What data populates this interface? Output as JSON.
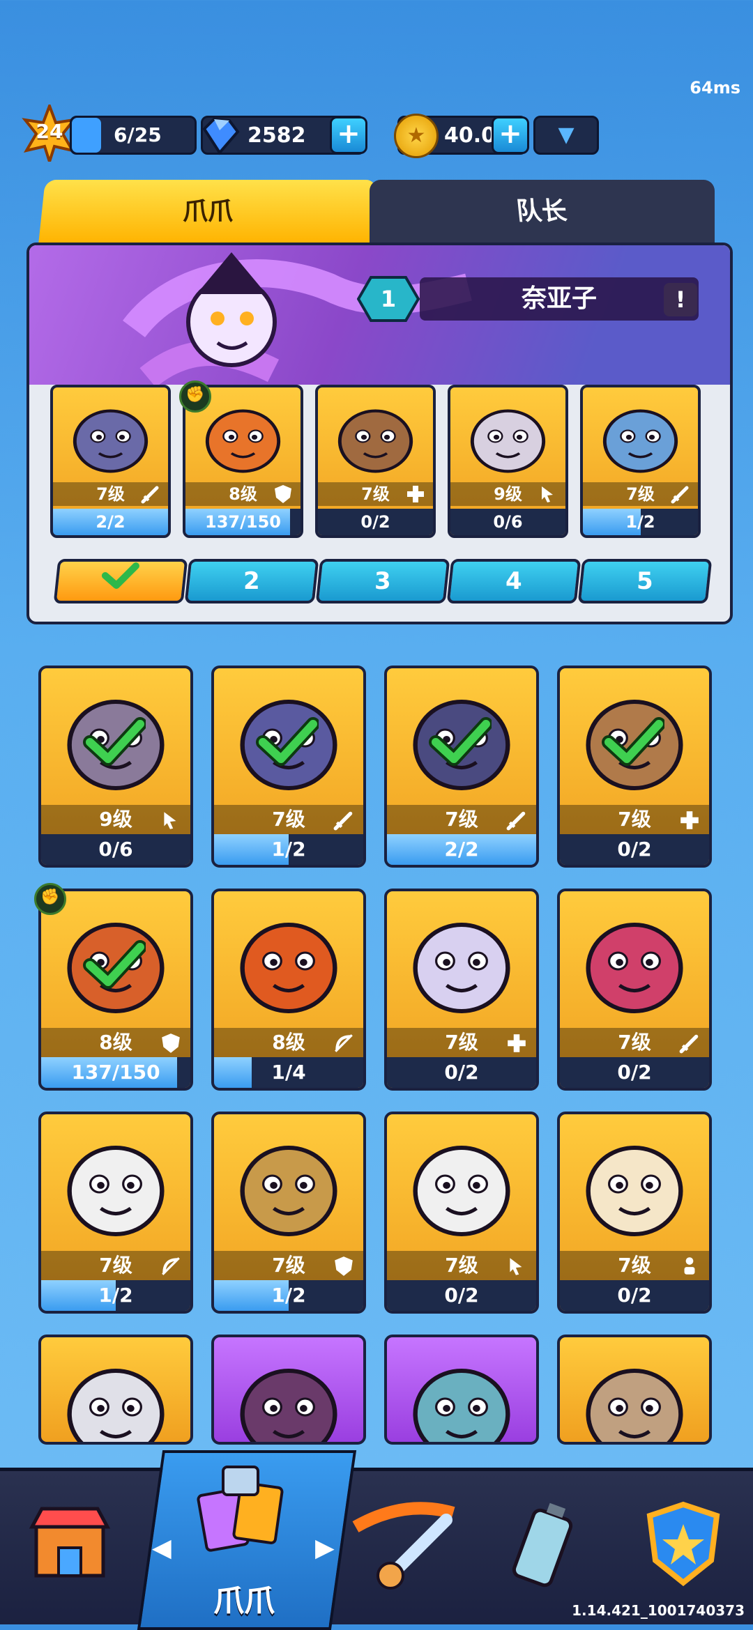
{
  "ping": "64ms",
  "topbar": {
    "player_level": "24",
    "xp": "6/25",
    "xp_fraction": 0.24,
    "gems": "2582",
    "coins": "40.0k"
  },
  "tabs": [
    "爪爪",
    "队长"
  ],
  "team": {
    "captain_slot": "1",
    "captain_name": "奈亚子",
    "info": "!",
    "members": [
      {
        "level": "7级",
        "progress": "2/2",
        "fill": 1.0,
        "class": "sword-icon"
      },
      {
        "level": "8级",
        "progress": "137/150",
        "fill": 0.91,
        "class": "shield-icon"
      },
      {
        "level": "7级",
        "progress": "0/2",
        "fill": 0,
        "class": "heal-icon"
      },
      {
        "level": "9级",
        "progress": "0/6",
        "fill": 0,
        "class": "cursor-icon"
      },
      {
        "level": "7级",
        "progress": "1/2",
        "fill": 0.5,
        "class": "sword-icon"
      }
    ],
    "slots": [
      "2",
      "3",
      "4",
      "5"
    ]
  },
  "grid": [
    {
      "level": "9级",
      "progress": "0/6",
      "fill": 0,
      "checked": true
    },
    {
      "level": "7级",
      "progress": "1/2",
      "fill": 0.5,
      "checked": true
    },
    {
      "level": "7级",
      "progress": "2/2",
      "fill": 1.0,
      "checked": true
    },
    {
      "level": "7级",
      "progress": "0/2",
      "fill": 0,
      "checked": true
    },
    {
      "level": "8级",
      "progress": "137/150",
      "fill": 0.91,
      "checked": true
    },
    {
      "level": "8级",
      "progress": "1/4",
      "fill": 0.25,
      "checked": false
    },
    {
      "level": "7级",
      "progress": "0/2",
      "fill": 0,
      "checked": false
    },
    {
      "level": "7级",
      "progress": "0/2",
      "fill": 0,
      "checked": false
    },
    {
      "level": "7级",
      "progress": "1/2",
      "fill": 0.5,
      "checked": false
    },
    {
      "level": "7级",
      "progress": "1/2",
      "fill": 0.5,
      "checked": false
    },
    {
      "level": "7级",
      "progress": "0/2",
      "fill": 0,
      "checked": false
    },
    {
      "level": "7级",
      "progress": "0/2",
      "fill": 0,
      "checked": false
    }
  ],
  "nav": {
    "active_label": "爪爪"
  },
  "version": "1.14.421_1001740373"
}
